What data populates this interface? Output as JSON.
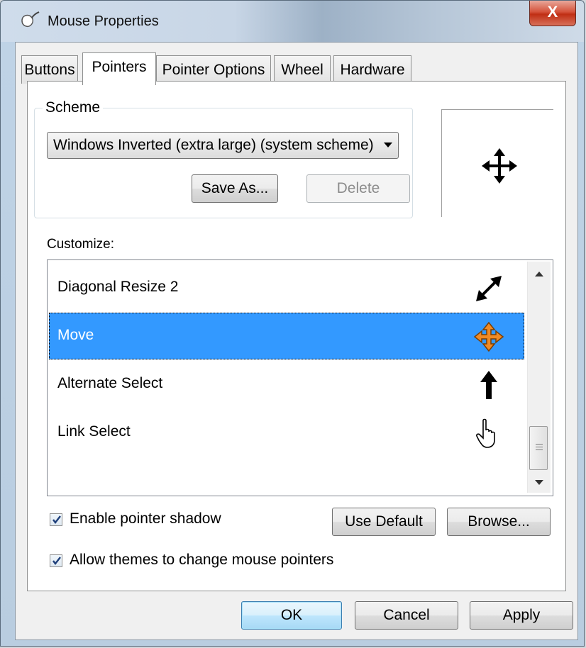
{
  "window": {
    "title": "Mouse Properties",
    "close_glyph": "X"
  },
  "tabs": [
    {
      "label": "Buttons"
    },
    {
      "label": "Pointers"
    },
    {
      "label": "Pointer Options"
    },
    {
      "label": "Wheel"
    },
    {
      "label": "Hardware"
    }
  ],
  "active_tab": "Pointers",
  "scheme": {
    "legend": "Scheme",
    "selected": "Windows Inverted (extra large) (system scheme)",
    "save_as_label": "Save As...",
    "delete_label": "Delete",
    "preview_icon": "move-cursor-icon"
  },
  "customize": {
    "label": "Customize:",
    "items": [
      {
        "label": "Diagonal Resize 2",
        "icon": "diagonal-resize-icon"
      },
      {
        "label": "Move",
        "icon": "move-cursor-icon",
        "selected": true
      },
      {
        "label": "Alternate Select",
        "icon": "up-arrow-icon"
      },
      {
        "label": "Link Select",
        "icon": "hand-pointer-icon"
      }
    ]
  },
  "options": {
    "enable_shadow_label": "Enable pointer shadow",
    "enable_shadow_checked": true,
    "allow_themes_label": "Allow themes to change mouse pointers",
    "allow_themes_checked": true,
    "use_default_label": "Use Default",
    "browse_label": "Browse..."
  },
  "footer": {
    "ok_label": "OK",
    "cancel_label": "Cancel",
    "apply_label": "Apply"
  },
  "colors": {
    "selection": "#3399ff",
    "move_icon_orange": "#f08a24",
    "close_red": "#c9391d"
  }
}
